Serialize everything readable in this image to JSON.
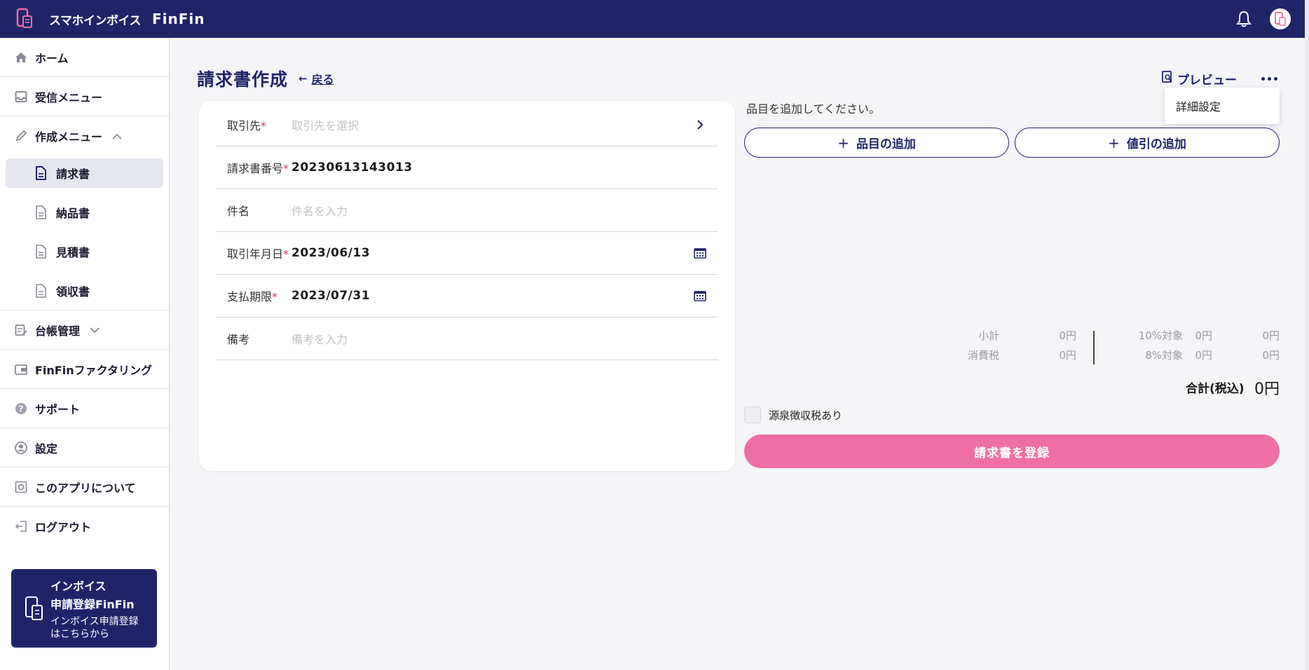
{
  "header": {
    "app_name": "スマホインボイス",
    "brand": "FinFin"
  },
  "sidebar": {
    "home": "ホーム",
    "inbox_menu": "受信メニュー",
    "create_menu": "作成メニュー",
    "sub_items": [
      "請求書",
      "納品書",
      "見積書",
      "領収書"
    ],
    "ledger": "台帳管理",
    "factoring": "FinFinファクタリング",
    "support": "サポート",
    "settings": "設定",
    "about": "このアプリについて",
    "logout": "ログアウト",
    "promo": {
      "title_line1": "インボイス",
      "title_line2": "申請登録FinFin",
      "subtitle_line1": "インボイス申請登録",
      "subtitle_line2": "はこちらから"
    }
  },
  "main": {
    "title": "請求書作成",
    "back": "戻る",
    "form": {
      "client_label": "取引先",
      "client_placeholder": "取引先を選択",
      "invoice_no_label": "請求書番号",
      "invoice_no_value": "20230613143013",
      "subject_label": "件名",
      "subject_placeholder": "件名を入力",
      "date_label": "取引年月日",
      "date_value": "2023/06/13",
      "due_label": "支払期限",
      "due_value": "2023/07/31",
      "note_label": "備考",
      "note_placeholder": "備考を入力",
      "required_mark": "*"
    },
    "preview": "プレビュー",
    "dropdown_item": "詳細設定",
    "hint": "品目を追加してください。",
    "add_item": "品目の追加",
    "add_discount": "値引の追加",
    "plus": "+",
    "totals": {
      "subtotal_label": "小計",
      "subtotal_value": "0円",
      "tax_label": "消費税",
      "tax_value": "0円",
      "rate10_label": "10%対象",
      "rate10_base": "0円",
      "rate10_tax": "0円",
      "rate8_label": "8%対象",
      "rate8_base": "0円",
      "rate8_tax": "0円",
      "grand_label": "合計(税込)",
      "grand_value": "0円"
    },
    "withholding_label": "源泉徴収税あり",
    "submit": "請求書を登録"
  },
  "colors": {
    "navy": "#1f2468",
    "pink": "#ee6fa4",
    "required": "#e0335a"
  }
}
